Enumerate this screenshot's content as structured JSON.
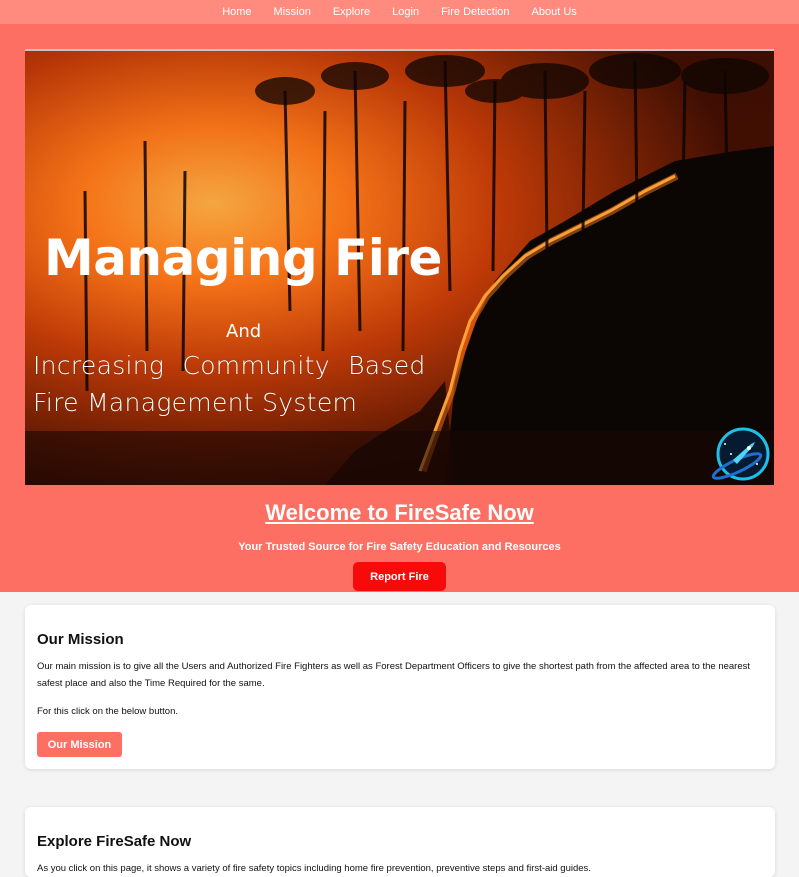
{
  "nav": {
    "items": [
      "Home",
      "Mission",
      "Explore",
      "Login",
      "Fire Detection",
      "About Us"
    ]
  },
  "banner": {
    "title": "Managing Fire",
    "and": "And",
    "line1": "Increasing Community Based",
    "line2": "Fire Management System"
  },
  "hero": {
    "welcome": "Welcome to FireSafe Now",
    "tagline": "Your Trusted Source for Fire Safety Education and Resources",
    "report_button": "Report Fire"
  },
  "mission": {
    "heading": "Our Mission",
    "text1": "Our main mission is to give all the Users and Authorized Fire Fighters as well as Forest Department Officers to give the shortest path from the affected area to the nearest safest place and also the Time Required for the same.",
    "text2": "For this click on the below button.",
    "button": "Our Mission"
  },
  "explore": {
    "heading": "Explore FireSafe Now",
    "text": "As you click on this page, it shows a variety of fire safety topics including home fire prevention, preventive steps and first-aid guides."
  },
  "colors": {
    "nav_bg": "#ff8b7e",
    "hero_bg": "#fd6f63",
    "report_btn": "#f80a0a"
  }
}
